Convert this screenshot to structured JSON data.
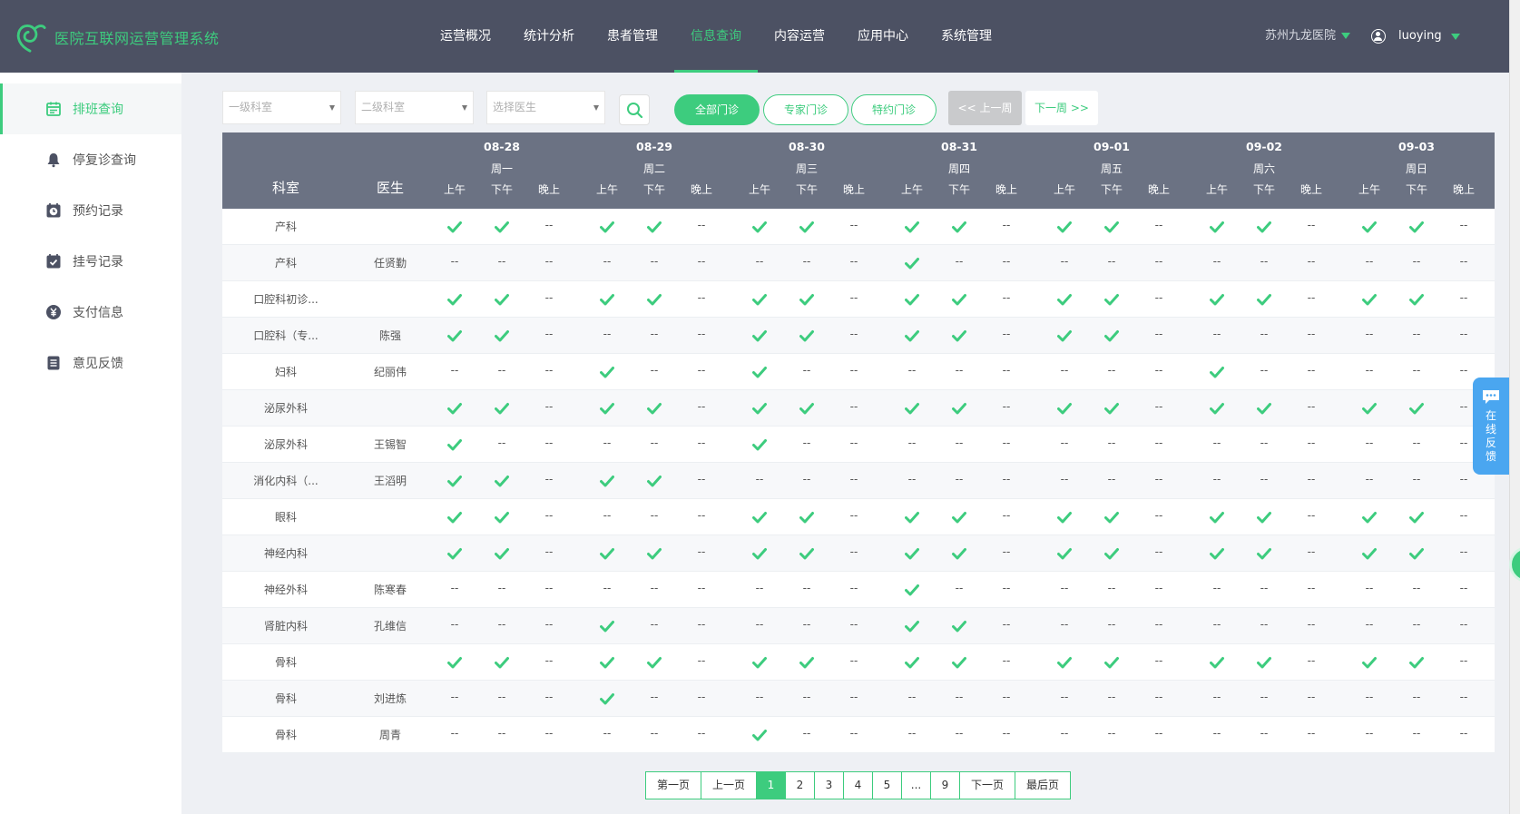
{
  "app": {
    "title": "医院互联网运营管理系统"
  },
  "nav": {
    "items": [
      "运营概况",
      "统计分析",
      "患者管理",
      "信息查询",
      "内容运营",
      "应用中心",
      "系统管理"
    ],
    "active_index": 3
  },
  "header": {
    "hospital": "苏州九龙医院",
    "username": "luoying"
  },
  "sidebar": {
    "items": [
      {
        "label": "排班查询",
        "icon": "calendar-icon",
        "active": true
      },
      {
        "label": "停复诊查询",
        "icon": "bell-icon",
        "active": false
      },
      {
        "label": "预约记录",
        "icon": "clock-icon",
        "active": false
      },
      {
        "label": "挂号记录",
        "icon": "calendar-check-icon",
        "active": false
      },
      {
        "label": "支付信息",
        "icon": "yen-icon",
        "active": false
      },
      {
        "label": "意见反馈",
        "icon": "document-icon",
        "active": false
      }
    ]
  },
  "filters": {
    "dept1_placeholder": "一级科室",
    "dept2_placeholder": "二级科室",
    "doctor_placeholder": "选择医生",
    "clinic_types": [
      "全部门诊",
      "专家门诊",
      "特约门诊"
    ],
    "active_clinic_type": 0,
    "prev_week": "<< 上一周",
    "next_week": "下一周 >>"
  },
  "table": {
    "col_dept": "科室",
    "col_doctor": "医生",
    "days": [
      {
        "date": "08-28",
        "weekday": "周一"
      },
      {
        "date": "08-29",
        "weekday": "周二"
      },
      {
        "date": "08-30",
        "weekday": "周三"
      },
      {
        "date": "08-31",
        "weekday": "周四"
      },
      {
        "date": "09-01",
        "weekday": "周五"
      },
      {
        "date": "09-02",
        "weekday": "周六"
      },
      {
        "date": "09-03",
        "weekday": "周日"
      }
    ],
    "slots": [
      "上午",
      "下午",
      "晚上"
    ],
    "empty_mark": "--",
    "rows": [
      {
        "dept": "产科",
        "doctor": "",
        "schedule": "110110110110110110110"
      },
      {
        "dept": "产科",
        "doctor": "任贤勤",
        "schedule": "000000000100000000000"
      },
      {
        "dept": "口腔科初诊...",
        "doctor": "",
        "schedule": "110110110110110110110"
      },
      {
        "dept": "口腔科（专...",
        "doctor": "陈强",
        "schedule": "110000110110110000000"
      },
      {
        "dept": "妇科",
        "doctor": "纪丽伟",
        "schedule": "000100100000000100000"
      },
      {
        "dept": "泌尿外科",
        "doctor": "",
        "schedule": "110110110110110110110"
      },
      {
        "dept": "泌尿外科",
        "doctor": "王锡智",
        "schedule": "100000100000000000000"
      },
      {
        "dept": "消化内科（...",
        "doctor": "王滔明",
        "schedule": "110110000000000000000"
      },
      {
        "dept": "眼科",
        "doctor": "",
        "schedule": "110000110110110110110"
      },
      {
        "dept": "神经内科",
        "doctor": "",
        "schedule": "110110110110110110110"
      },
      {
        "dept": "神经外科",
        "doctor": "陈寒春",
        "schedule": "000000000100000000000"
      },
      {
        "dept": "肾脏内科",
        "doctor": "孔维信",
        "schedule": "000100000110000000000"
      },
      {
        "dept": "骨科",
        "doctor": "",
        "schedule": "110110110110110110110"
      },
      {
        "dept": "骨科",
        "doctor": "刘进炼",
        "schedule": "000100000000000000000"
      },
      {
        "dept": "骨科",
        "doctor": "周青",
        "schedule": "000000100000000000000"
      }
    ]
  },
  "pagination": {
    "first": "第一页",
    "prev": "上一页",
    "pages": [
      "1",
      "2",
      "3",
      "4",
      "5",
      "...",
      "9"
    ],
    "current": "1",
    "next": "下一页",
    "last": "最后页"
  },
  "float": {
    "feedback_label": "在线反馈"
  },
  "colors": {
    "accent": "#3dcc7e",
    "header_bg": "#4c5163",
    "table_head": "#6b7283",
    "float_blue": "#4aa6f0"
  }
}
